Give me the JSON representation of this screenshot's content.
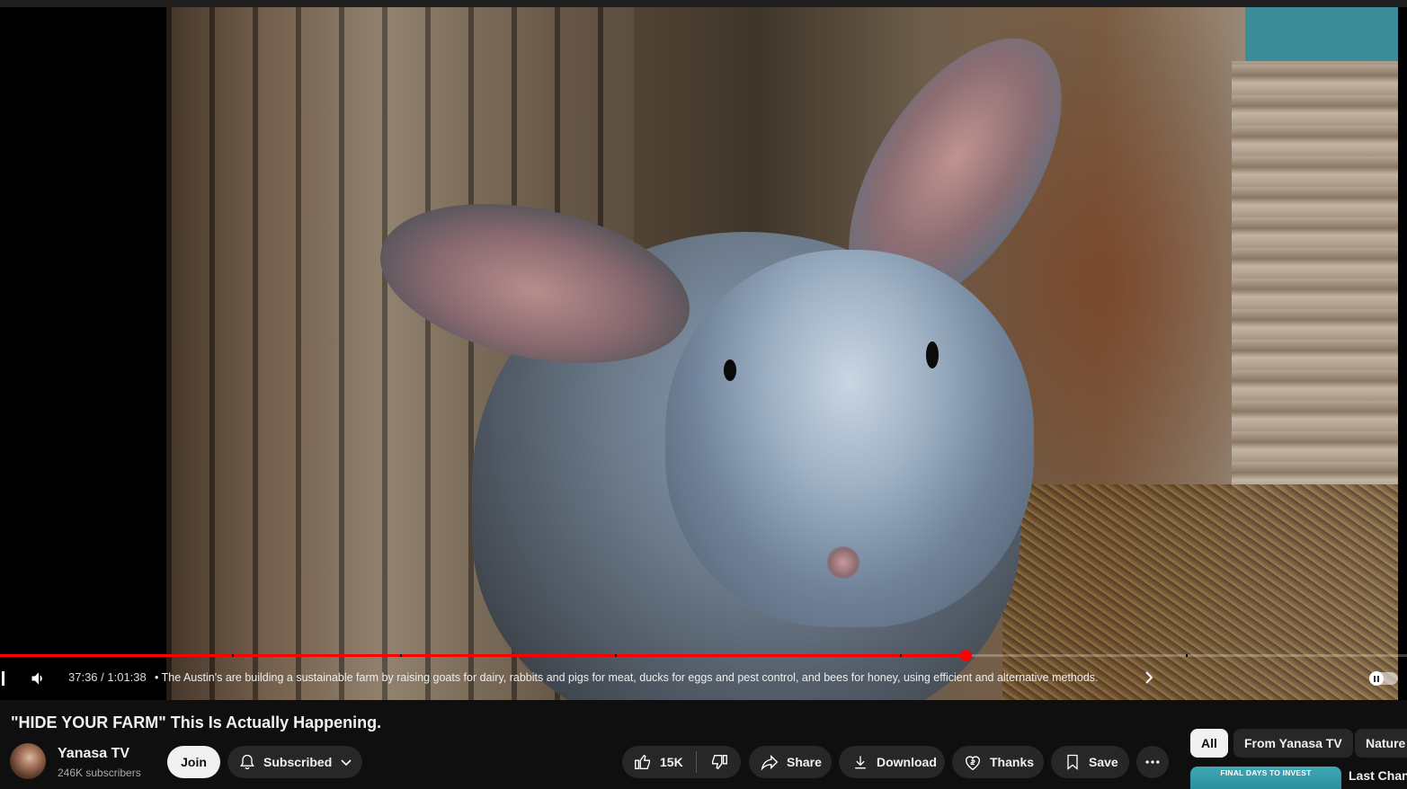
{
  "player": {
    "progress_fraction": 0.6865,
    "time_display": "37:36 / 1:01:38",
    "chapter_bullet": "•",
    "chapter_text": "The Austin's are building a sustainable farm by raising goats for dairy, rabbits and pigs for meat, ducks for eggs and pest control, and bees for honey, using efficient and alternative methods."
  },
  "video": {
    "title": "\"HIDE YOUR FARM\" This Is Actually Happening."
  },
  "channel": {
    "name": "Yanasa TV",
    "subscribers": "246K subscribers",
    "join_label": "Join",
    "subscribed_label": "Subscribed"
  },
  "actions": {
    "like_count": "15K",
    "share_label": "Share",
    "download_label": "Download",
    "thanks_label": "Thanks",
    "save_label": "Save"
  },
  "chips": [
    {
      "label": "All",
      "active": true
    },
    {
      "label": "From Yanasa TV",
      "active": false
    },
    {
      "label": "Nature",
      "active": false
    }
  ],
  "recommended": {
    "thumb_text": "FINAL DAYS TO INVEST",
    "title": "Last Chanc"
  },
  "colors": {
    "progress_played": "#ff0000",
    "background": "#0f0f0f",
    "button": "#272727"
  },
  "icons": [
    "volume-icon",
    "chevron-right-icon",
    "bell-icon",
    "chevron-down-icon",
    "thumbs-up-icon",
    "thumbs-down-icon",
    "share-icon",
    "download-icon",
    "thanks-icon",
    "bookmark-icon",
    "more-icon",
    "pause-icon"
  ]
}
